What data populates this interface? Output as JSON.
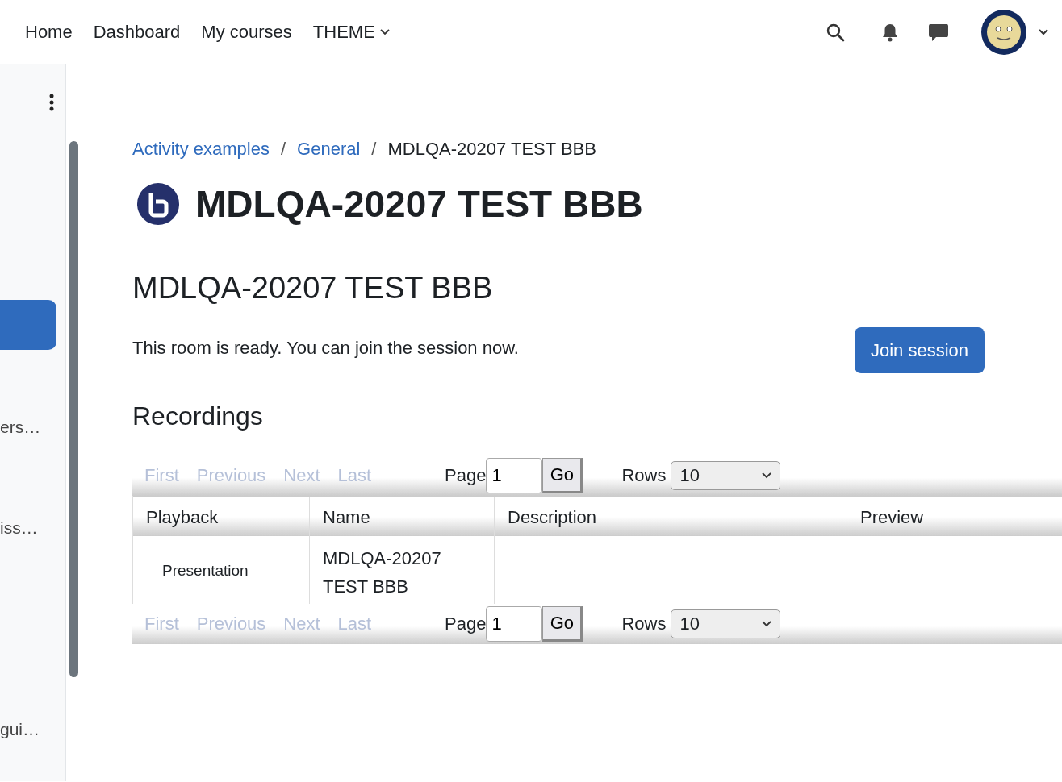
{
  "navbar": {
    "links": [
      {
        "label": "Home"
      },
      {
        "label": "Dashboard"
      },
      {
        "label": "My courses"
      },
      {
        "label": "THEME",
        "dropdown": true
      }
    ]
  },
  "sidebar": {
    "items": [
      {
        "selected": true
      },
      {
        "label": "ers…",
        "selected": false
      },
      {
        "label": "iss…",
        "selected": false
      },
      {
        "label": "gui…",
        "selected": false
      }
    ]
  },
  "breadcrumb": [
    {
      "kind": "link",
      "label": "Activity examples"
    },
    {
      "kind": "separator",
      "label": "/"
    },
    {
      "kind": "link",
      "label": "General"
    },
    {
      "kind": "separator",
      "label": "/"
    },
    {
      "kind": "current",
      "label": "MDLQA-20207 TEST BBB"
    }
  ],
  "page_title": "MDLQA-20207 TEST BBB",
  "room": {
    "heading": "MDLQA-20207 TEST BBB",
    "message": "This room is ready. You can join the session now.",
    "join_button": "Join session"
  },
  "recordings": {
    "heading": "Recordings",
    "pagination_top": {
      "links": [
        {
          "label": "First",
          "disabled": true
        },
        {
          "label": "Previous",
          "disabled": true
        },
        {
          "label": "Next",
          "disabled": true
        },
        {
          "label": "Last",
          "disabled": true
        }
      ],
      "page_label": "Page",
      "page_value": "1",
      "go": "Go",
      "rows_label": "Rows",
      "rows_value": "10"
    },
    "columns": [
      "Playback",
      "Name",
      "Description",
      "Preview"
    ],
    "rows": [
      [
        "Presentation",
        "MDLQA-20207 TEST BBB",
        "",
        ""
      ]
    ],
    "pagination_bottom": {
      "links": [
        {
          "label": "First",
          "disabled": true
        },
        {
          "label": "Previous",
          "disabled": true
        },
        {
          "label": "Next",
          "disabled": true
        },
        {
          "label": "Last",
          "disabled": true
        }
      ],
      "page_label": "Page",
      "page_value": "1",
      "go": "Go",
      "rows_label": "Rows",
      "rows_value": "10"
    }
  }
}
